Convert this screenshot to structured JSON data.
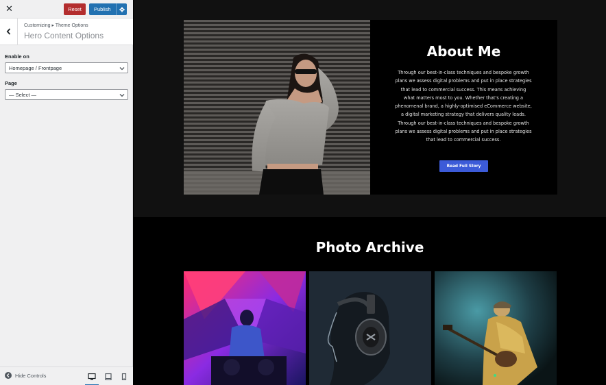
{
  "sidebar": {
    "close_label": "✕",
    "reset_label": "Reset",
    "publish_label": "Publish",
    "breadcrumb": "Customizing ▸ Theme Options",
    "section_title": "Hero Content Options",
    "controls": [
      {
        "label": "Enable on",
        "value": "Homepage / Frontpage"
      },
      {
        "label": "Page",
        "value": "— Select —"
      }
    ],
    "footer": {
      "hide_controls_label": "Hide Controls",
      "devices": [
        "desktop-icon",
        "tablet-icon",
        "mobile-icon"
      ],
      "active_device": "desktop"
    },
    "colors": {
      "reset": "#b32d2e",
      "publish": "#2271b1",
      "panel": "#f0f0f1"
    }
  },
  "preview": {
    "about": {
      "title": "About Me",
      "body": "Through our best-in-class techniques and bespoke growth plans we assess digital problems and put in place strategies that lead to commercial success. This means achieving what matters most to you. Whether that's creating a phenomenal brand, a highly-optimised eCommerce website, a digital marketing strategy that delivers quality leads. Through our best-in-class techniques and bespoke growth plans we assess digital problems and put in place strategies that lead to commercial success.",
      "button_label": "Read Full Story",
      "button_color": "#3c5bd8"
    },
    "archive": {
      "title": "Photo Archive"
    }
  }
}
